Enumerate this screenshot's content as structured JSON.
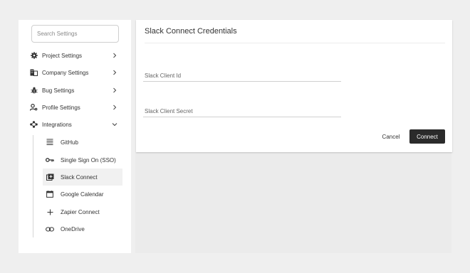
{
  "sidebar": {
    "search_placeholder": "Search Settings",
    "items": [
      {
        "label": "Project Settings",
        "icon": "gear-icon",
        "chevron": "right"
      },
      {
        "label": "Company Settings",
        "icon": "building-icon",
        "chevron": "right"
      },
      {
        "label": "Bug Settings",
        "icon": "bug-icon",
        "chevron": "right"
      },
      {
        "label": "Profile Settings",
        "icon": "user-cog-icon",
        "chevron": "right"
      },
      {
        "label": "Integrations",
        "icon": "integrations-icon",
        "chevron": "down"
      }
    ],
    "integrations": [
      {
        "label": "GitHub",
        "icon": "list-icon"
      },
      {
        "label": "Single Sign On (SSO)",
        "icon": "key-icon"
      },
      {
        "label": "Slack Connect",
        "icon": "slack-connect-icon",
        "active": true
      },
      {
        "label": "Google Calendar",
        "icon": "calendar-icon"
      },
      {
        "label": "Zapier Connect",
        "icon": "plus-icon"
      },
      {
        "label": "OneDrive",
        "icon": "link-icon"
      }
    ]
  },
  "panel": {
    "title": "Slack Connect Credentials",
    "client_id_placeholder": "Slack Client Id",
    "client_id_value": "",
    "client_secret_placeholder": "Slack Client Secret",
    "client_secret_value": "",
    "cancel_label": "Cancel",
    "connect_label": "Connect"
  },
  "colors": {
    "page_bg": "#efefef",
    "accent_button": "#2b2b2b",
    "active_item_bg": "#f1f1f1"
  }
}
